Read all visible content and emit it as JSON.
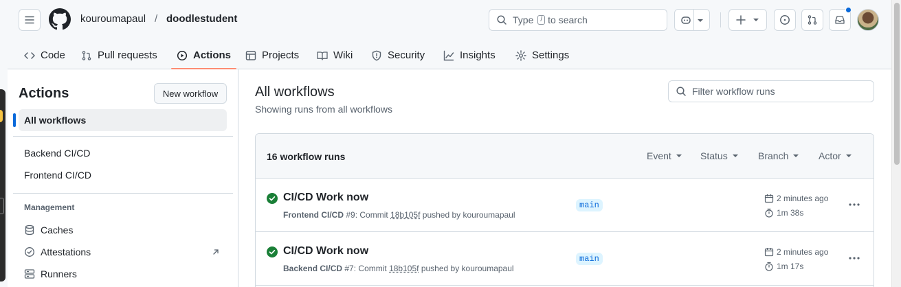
{
  "header": {
    "owner": "kouroumapaul",
    "separator": "/",
    "repo": "doodlestudent",
    "search_prefix": "Type",
    "search_key": "/",
    "search_suffix": "to search"
  },
  "tabs": [
    {
      "label": "Code",
      "icon": "code-icon"
    },
    {
      "label": "Pull requests",
      "icon": "git-pull-request-icon"
    },
    {
      "label": "Actions",
      "icon": "play-icon"
    },
    {
      "label": "Projects",
      "icon": "table-icon"
    },
    {
      "label": "Wiki",
      "icon": "book-icon"
    },
    {
      "label": "Security",
      "icon": "shield-icon"
    },
    {
      "label": "Insights",
      "icon": "graph-icon"
    },
    {
      "label": "Settings",
      "icon": "gear-icon"
    }
  ],
  "sidebar": {
    "title": "Actions",
    "new_workflow": "New workflow",
    "all_workflows": "All workflows",
    "workflows": [
      "Backend CI/CD",
      "Frontend CI/CD"
    ],
    "management_heading": "Management",
    "management": [
      {
        "label": "Caches",
        "icon": "database-icon"
      },
      {
        "label": "Attestations",
        "icon": "verified-icon"
      },
      {
        "label": "Runners",
        "icon": "server-icon"
      }
    ]
  },
  "main": {
    "title": "All workflows",
    "subtitle": "Showing runs from all workflows",
    "filter_placeholder": "Filter workflow runs",
    "runs_count": "16 workflow runs",
    "filters": [
      "Event",
      "Status",
      "Branch",
      "Actor"
    ],
    "runs": [
      {
        "title": "CI/CD Work now",
        "workflow": "Frontend CI/CD",
        "number": "#9",
        "commit_prefix": ": Commit",
        "sha": "18b105f",
        "pushed_by": "pushed by kouroumapaul",
        "branch": "main",
        "time_ago": "2 minutes ago",
        "duration": "1m 38s",
        "status": "success"
      },
      {
        "title": "CI/CD Work now",
        "workflow": "Backend CI/CD",
        "number": "#7",
        "commit_prefix": ": Commit",
        "sha": "18b105f",
        "pushed_by": "pushed by kouroumapaul",
        "branch": "main",
        "time_ago": "2 minutes ago",
        "duration": "1m 17s",
        "status": "success"
      }
    ]
  },
  "colors": {
    "accent": "#0969da",
    "success": "#1a7f37",
    "active_tab_underline": "#fd8c73",
    "branch_bg": "#ddf4ff"
  }
}
